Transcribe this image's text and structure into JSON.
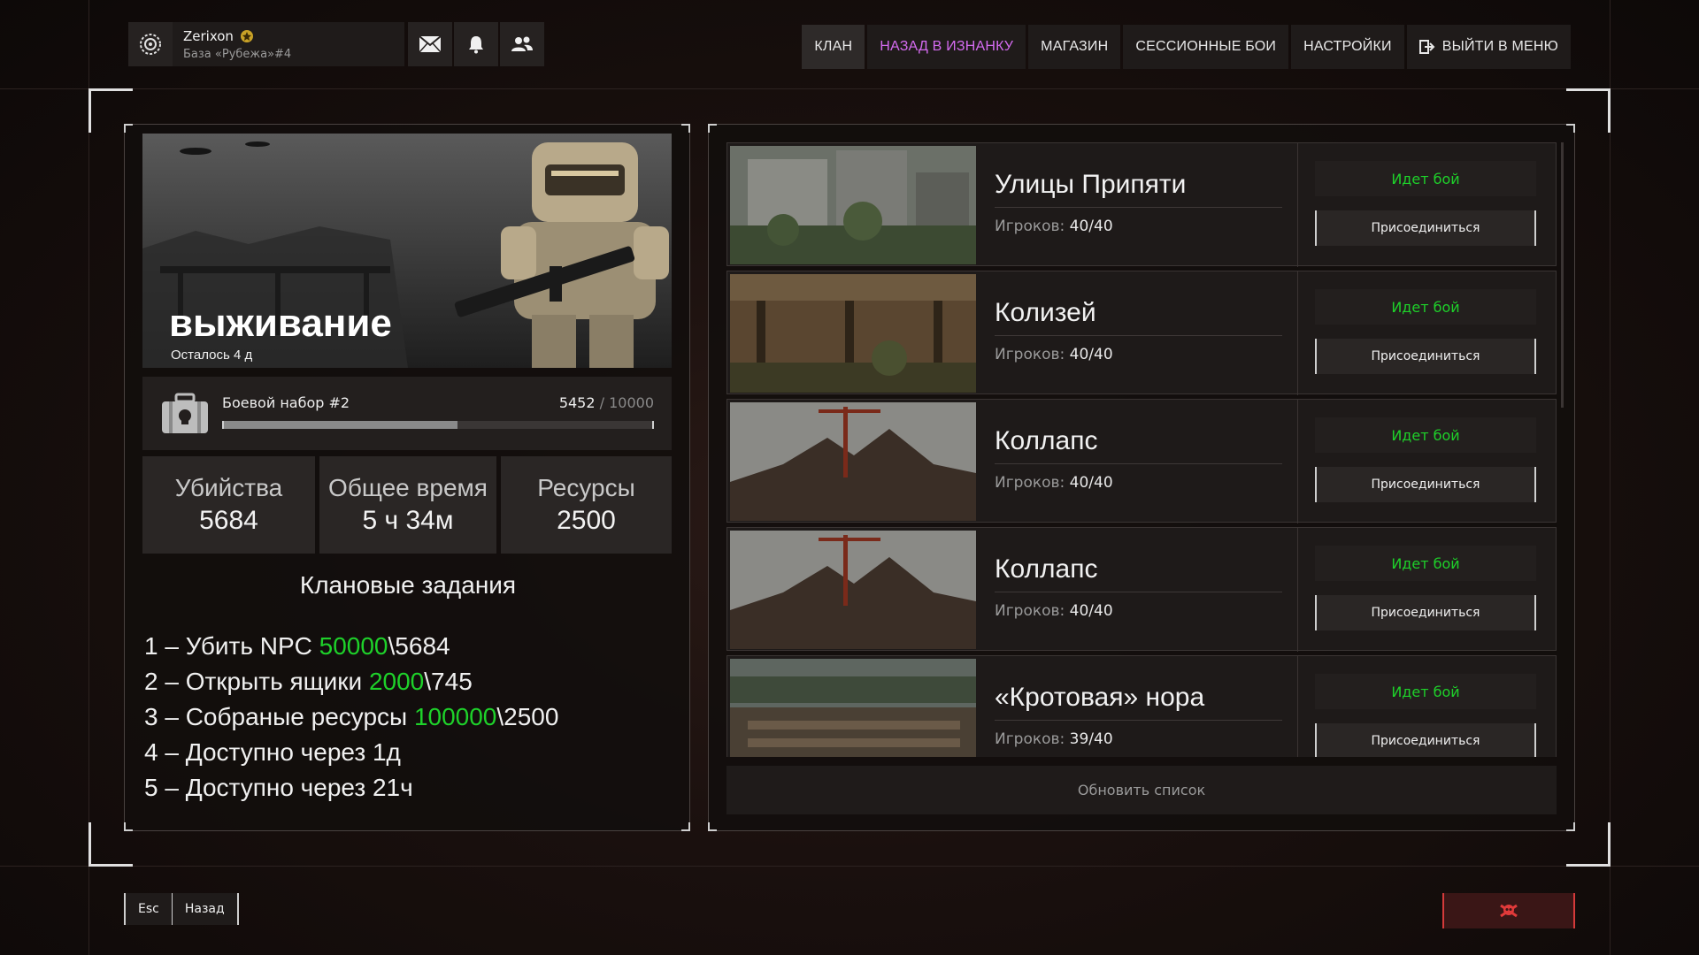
{
  "profile": {
    "name": "Zerixon",
    "base": "База «Рубежа»#4"
  },
  "nav": {
    "tabs": [
      {
        "label": "КЛАН"
      },
      {
        "label": "НАЗАД В ИЗНАНКУ"
      },
      {
        "label": "МАГАЗИН"
      },
      {
        "label": "СЕССИОННЫЕ БОИ"
      },
      {
        "label": "НАСТРОЙКИ"
      },
      {
        "label": "ВЫЙТИ В МЕНЮ"
      }
    ]
  },
  "mode": {
    "title": "выживание",
    "time_left": "Осталось 4 д"
  },
  "kit": {
    "title": "Боевой набор #2",
    "current": "5452",
    "max": "10000",
    "progress_fraction": 0.5452
  },
  "stats": [
    {
      "label": "Убийства",
      "value": "5684"
    },
    {
      "label": "Общее время",
      "value": "5 ч 34м"
    },
    {
      "label": "Ресурсы",
      "value": "2500"
    }
  ],
  "quests": {
    "title": "Клановые задания",
    "items": [
      {
        "prefix": "1 – Убить NPC ",
        "target": "50000",
        "suffix": "\\5684"
      },
      {
        "prefix": "2 – Открыть ящики ",
        "target": "2000",
        "suffix": "\\745"
      },
      {
        "prefix": "3 – Собраные ресурсы ",
        "target": "100000",
        "suffix": "\\2500"
      },
      {
        "prefix": "4 – Доступно через 1д",
        "target": "",
        "suffix": ""
      },
      {
        "prefix": "5 – Доступно через 21ч",
        "target": "",
        "suffix": ""
      }
    ]
  },
  "servers": [
    {
      "name": "Улицы Припяти",
      "players_label": "Игроков:",
      "players": "40/40",
      "status": "Идет бой",
      "join": "Присоединиться"
    },
    {
      "name": "Колизей",
      "players_label": "Игроков:",
      "players": "40/40",
      "status": "Идет бой",
      "join": "Присоединиться"
    },
    {
      "name": "Коллапс",
      "players_label": "Игроков:",
      "players": "40/40",
      "status": "Идет бой",
      "join": "Присоединиться"
    },
    {
      "name": "Коллапс",
      "players_label": "Игроков:",
      "players": "40/40",
      "status": "Идет бой",
      "join": "Присоединиться"
    },
    {
      "name": "«Кротовая» нора",
      "players_label": "Игроков:",
      "players": "39/40",
      "status": "Идет бой",
      "join": "Присоединиться"
    }
  ],
  "refresh_label": "Обновить список",
  "bottom": {
    "esc": "Esc",
    "back": "Назад"
  },
  "colors": {
    "accent_green": "#1ed12a",
    "accent_purple": "#d46bf0",
    "danger_red": "#d43a3a"
  }
}
